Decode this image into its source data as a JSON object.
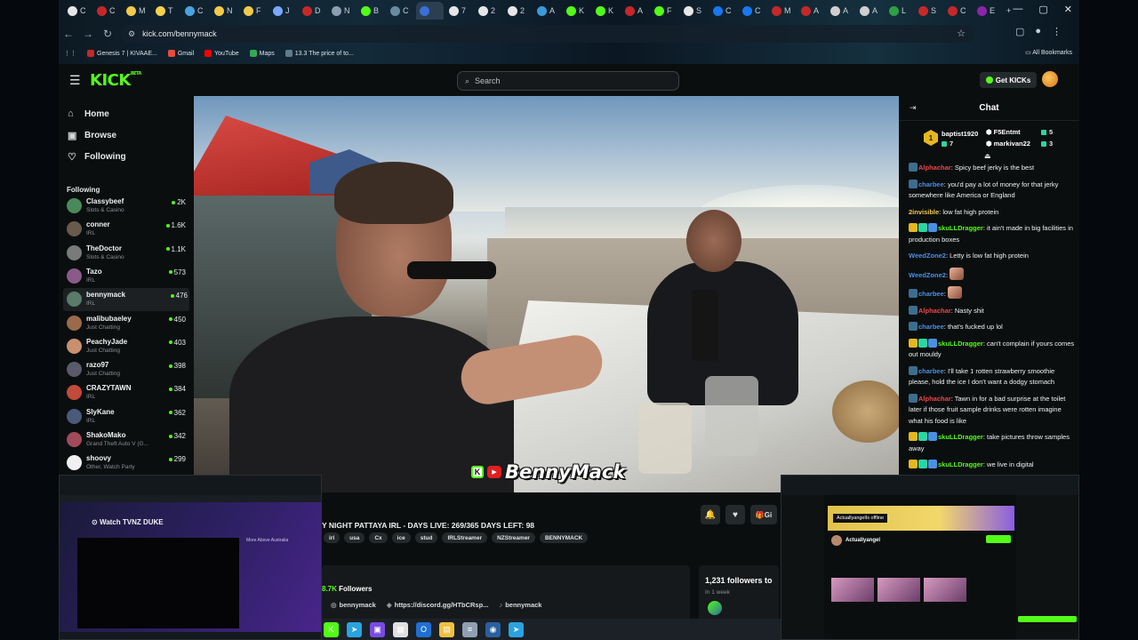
{
  "browser": {
    "url": "kick.com/bennymack",
    "tabs": [
      {
        "label": "C",
        "color": "#e6e6e6"
      },
      {
        "label": "C",
        "color": "#c62828"
      },
      {
        "label": "M",
        "color": "#f2c94c"
      },
      {
        "label": "T",
        "color": "#f5d04b"
      },
      {
        "label": "C",
        "color": "#4aa3df"
      },
      {
        "label": "N",
        "color": "#f2c94c"
      },
      {
        "label": "F",
        "color": "#f2c94c"
      },
      {
        "label": "J",
        "color": "#7aa8ff"
      },
      {
        "label": "D",
        "color": "#c62828"
      },
      {
        "label": "N",
        "color": "#8aa0b0"
      },
      {
        "label": "B",
        "color": "#53fc18"
      },
      {
        "label": "C",
        "color": "#6a8aa0"
      },
      {
        "label": "",
        "color": "#3a6fd8"
      },
      {
        "label": "7",
        "color": "#e6e6e6"
      },
      {
        "label": "2",
        "color": "#e6e6e6"
      },
      {
        "label": "2",
        "color": "#e6e6e6"
      },
      {
        "label": "A",
        "color": "#3a9ad8"
      },
      {
        "label": "K",
        "color": "#53fc18"
      },
      {
        "label": "K",
        "color": "#53fc18"
      },
      {
        "label": "A",
        "color": "#c62828"
      },
      {
        "label": "F",
        "color": "#53fc18"
      },
      {
        "label": "S",
        "color": "#e6e6e6"
      },
      {
        "label": "C",
        "color": "#1877f2"
      },
      {
        "label": "C",
        "color": "#1877f2"
      },
      {
        "label": "M",
        "color": "#c62828"
      },
      {
        "label": "A",
        "color": "#c62828"
      },
      {
        "label": "A",
        "color": "#cfcfcf"
      },
      {
        "label": "A",
        "color": "#cfcfcf"
      },
      {
        "label": "L",
        "color": "#2f9e44"
      },
      {
        "label": "S",
        "color": "#c62828"
      },
      {
        "label": "C",
        "color": "#c62828"
      },
      {
        "label": "E",
        "color": "#8e24aa"
      }
    ],
    "bookmarks": [
      {
        "label": "Genesis 7 | KIVAAE...",
        "color": "#c62828"
      },
      {
        "label": "Gmail",
        "color": "#e74c3c"
      },
      {
        "label": "YouTube",
        "color": "#ff0000"
      },
      {
        "label": "Maps",
        "color": "#34a853"
      },
      {
        "label": "13.3 The price of to...",
        "color": "#5e7c8a"
      }
    ],
    "all_bookmarks": "All Bookmarks"
  },
  "kick": {
    "logo": "KICK",
    "logo_badge": "BETA",
    "search_placeholder": "Search",
    "get_kicks": "Get KICKs",
    "nav": [
      {
        "label": "Home",
        "icon": "⌂"
      },
      {
        "label": "Browse",
        "icon": "▣"
      },
      {
        "label": "Following",
        "icon": "♡"
      }
    ],
    "following_label": "Following",
    "channels": [
      {
        "name": "Classybeef",
        "category": "Slots & Casino",
        "viewers": "2K",
        "color": "#4a8a5a"
      },
      {
        "name": "conner",
        "category": "IRL",
        "viewers": "1.6K",
        "color": "#6a5a4a"
      },
      {
        "name": "TheDoctor",
        "category": "Slots & Casino",
        "viewers": "1.1K",
        "color": "#7a7a7a"
      },
      {
        "name": "Tazo",
        "category": "IRL",
        "viewers": "573",
        "color": "#8a5a8a"
      },
      {
        "name": "bennymack",
        "category": "IRL",
        "viewers": "476",
        "color": "#5a7a6a",
        "active": true
      },
      {
        "name": "malibubaeley",
        "category": "Just Chatting",
        "viewers": "450",
        "color": "#9a6a4a"
      },
      {
        "name": "PeachyJade",
        "category": "Just Chatting",
        "viewers": "403",
        "color": "#c99070"
      },
      {
        "name": "razo97",
        "category": "Just Chatting",
        "viewers": "398",
        "color": "#5a5a6a"
      },
      {
        "name": "CRAZYTAWN",
        "category": "IRL",
        "viewers": "384",
        "color": "#c24a3a"
      },
      {
        "name": "SlyKane",
        "category": "IRL",
        "viewers": "362",
        "color": "#4a5a7a"
      },
      {
        "name": "ShakoMako",
        "category": "Grand Theft Auto V (G...",
        "viewers": "342",
        "color": "#a04a5a"
      },
      {
        "name": "shoovy",
        "category": "Other, Watch Party",
        "viewers": "299",
        "color": "#f0f0f0"
      }
    ],
    "stream": {
      "overlay_name": "BennyMack",
      "title": "Y NIGHT PATTAYA IRL - DAYS LIVE: 269/365 DAYS LEFT: 98",
      "tags": [
        "irl",
        "usa",
        "Cx",
        "ice",
        "stud",
        "IRLStreamer",
        "NZStreamer",
        "BENNYMACK"
      ],
      "gift_label": "Gi",
      "followers_num": "8.7K",
      "followers_label": "Followers",
      "links": [
        {
          "icon": "◎",
          "label": "bennymack"
        },
        {
          "icon": "◈",
          "label": "https://discord.gg/HTbCRsp..."
        },
        {
          "icon": "♪",
          "label": "bennymack"
        }
      ],
      "goal_title": "1,231 followers to",
      "goal_sub": "In 1 week"
    },
    "chat": {
      "title": "Chat",
      "leaders": [
        {
          "name": "baptist1920",
          "count": "7",
          "color": "#e6b71f"
        },
        {
          "name": "F5Entmt",
          "count": "5",
          "color": "#d9dde0"
        },
        {
          "name": "markivan22",
          "count": "3",
          "color": "#e07b39"
        }
      ],
      "messages": [
        {
          "user": "Alphachar",
          "color": "#e84a4a",
          "text": ": Spicy beef jerky is the best",
          "badges": 1
        },
        {
          "user": "charbee",
          "color": "#4a90e2",
          "text": ": you'd pay a lot of money for that jerky somewhere like America or England",
          "badges": 1
        },
        {
          "user": "2invisible",
          "color": "#f2c94c",
          "text": ": low fat high protein",
          "badges": 0
        },
        {
          "user": "skuLLDragger",
          "color": "#53fc18",
          "text": ": it ain't made in big facilities in production boxes",
          "badges": 3
        },
        {
          "user": "WeedZone2",
          "color": "#4a90e2",
          "text": ": Letty is low fat high protein",
          "badges": 0
        },
        {
          "user": "WeedZone2",
          "color": "#4a90e2",
          "text": ":",
          "badges": 0,
          "emote": true
        },
        {
          "user": "charbee",
          "color": "#4a90e2",
          "text": ":",
          "badges": 1,
          "emote": true
        },
        {
          "user": "Alphachar",
          "color": "#e84a4a",
          "text": ": Nasty shit",
          "badges": 1
        },
        {
          "user": "charbee",
          "color": "#4a90e2",
          "text": ": that's fucked up lol",
          "badges": 1
        },
        {
          "user": "skuLLDragger",
          "color": "#53fc18",
          "text": ": can't complain if yours comes out mouldy",
          "badges": 3
        },
        {
          "user": "charbee",
          "color": "#4a90e2",
          "text": ": I'll take 1 rotten strawberry smoothie please, hold the ice I don't want a dodgy stomach",
          "badges": 1
        },
        {
          "user": "Alphachar",
          "color": "#e84a4a",
          "text": ": Tawn in for a bad surprise at the toilet later if those fruit sample drinks were rotten imagine what his food is like",
          "badges": 1
        },
        {
          "user": "skuLLDragger",
          "color": "#53fc18",
          "text": ": take pictures throw samples away",
          "badges": 3
        },
        {
          "user": "skuLLDragger",
          "color": "#53fc18",
          "text": ": we live in digital",
          "badges": 3
        }
      ]
    }
  },
  "pip_left": {
    "watch_title": "Watch TVNZ DUKE",
    "side_text": "More Above Australia"
  },
  "pip_right": {
    "offline_label": "ActuallyangelIs offline",
    "profile_name": "Actuallyangel"
  },
  "taskbar": [
    {
      "icon": "K",
      "color": "#53fc18"
    },
    {
      "icon": "➤",
      "color": "#2aa3e0"
    },
    {
      "icon": "▣",
      "color": "#7a4be0"
    },
    {
      "icon": "▦",
      "color": "#e0e0e0"
    },
    {
      "icon": "O",
      "color": "#1f6fd0"
    },
    {
      "icon": "▤",
      "color": "#f0c040"
    },
    {
      "icon": "≡",
      "color": "#90a0b0"
    },
    {
      "icon": "◉",
      "color": "#2a5fa0"
    },
    {
      "icon": "➤",
      "color": "#2aa3e0"
    }
  ]
}
